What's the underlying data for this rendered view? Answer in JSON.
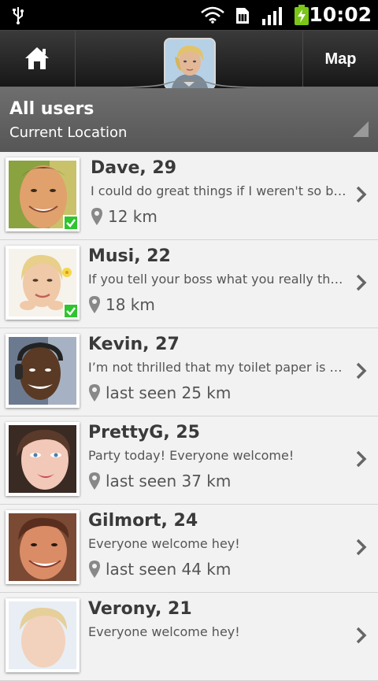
{
  "status_bar": {
    "time": "10:02",
    "icons": [
      "usb-icon",
      "wifi-icon",
      "sim-card-icon",
      "signal-icon",
      "battery-charging-icon"
    ],
    "battery_color": "#7bc618"
  },
  "action_bar": {
    "home_icon": "home-icon",
    "map_label": "Map"
  },
  "filter": {
    "title": "All users",
    "subtitle": "Current Location"
  },
  "users": [
    {
      "name": "Dave, 29",
      "message": "I could do great things if I weren't so busy",
      "distance": "12 km",
      "online": true
    },
    {
      "name": "Musi, 22",
      "message": "If you tell your boss what you really think",
      "distance": "18 km",
      "online": true
    },
    {
      "name": "Kevin, 27",
      "message": "I’m not thrilled that my toilet paper is gone",
      "distance": "last seen 25 km",
      "online": false
    },
    {
      "name": "PrettyG, 25",
      "message": "Party today! Everyone welcome!",
      "distance": "last seen 37 km",
      "online": false
    },
    {
      "name": "Gilmort, 24",
      "message": "Everyone welcome hey!",
      "distance": "last seen 44 km",
      "online": false
    },
    {
      "name": "Verony, 21",
      "message": "Everyone welcome hey!",
      "distance": "",
      "online": false
    }
  ],
  "colors": {
    "online_badge": "#2ec52e",
    "header_bg": "#626262",
    "row_bg": "#f2f2f2"
  }
}
